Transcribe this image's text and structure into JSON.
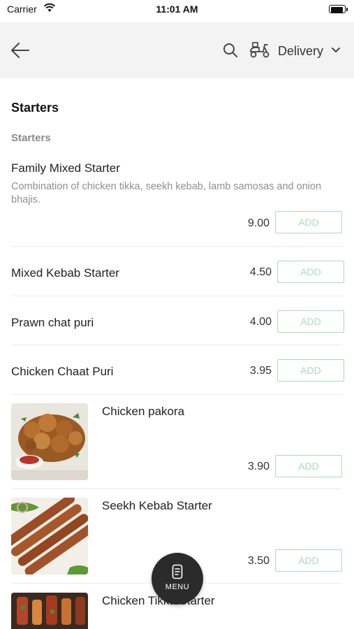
{
  "status_bar": {
    "carrier": "Carrier",
    "time": "11:01 AM"
  },
  "header": {
    "order_mode": "Delivery"
  },
  "section": {
    "title": "Starters",
    "subheading": "Starters"
  },
  "items": [
    {
      "name": "Family Mixed Starter",
      "description": "Combination of chicken tikka, seekh kebab, lamb samosas and onion bhajis.",
      "price": "9.00",
      "add_label": "ADD"
    },
    {
      "name": "Mixed Kebab Starter",
      "price": "4.50",
      "add_label": "ADD"
    },
    {
      "name": "Prawn chat puri",
      "price": "4.00",
      "add_label": "ADD"
    },
    {
      "name": "Chicken Chaat Puri",
      "price": "3.95",
      "add_label": "ADD"
    },
    {
      "name": "Chicken pakora",
      "price": "3.90",
      "add_label": "ADD"
    },
    {
      "name": "Seekh Kebab Starter",
      "price": "3.50",
      "add_label": "ADD"
    },
    {
      "name": "Chicken Tikka Starter"
    }
  ],
  "menu_button": {
    "label": "MENU"
  },
  "colors": {
    "accent_green": "#a9dbbd",
    "header_bg": "#f3f3f3",
    "fab_bg": "#2b2b2b"
  },
  "icons": [
    "back-arrow-icon",
    "search-icon",
    "scooter-icon",
    "chevron-down-icon",
    "menu-icon",
    "wifi-icon",
    "battery-icon"
  ]
}
